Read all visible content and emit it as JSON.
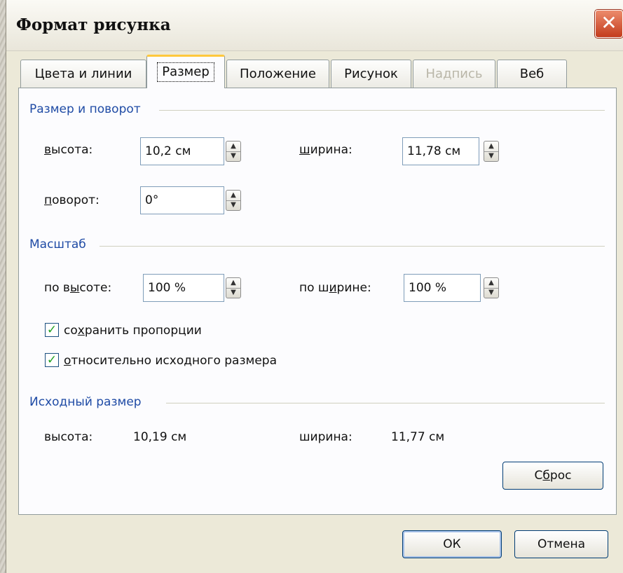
{
  "dialog": {
    "title": "Формат рисунка",
    "close_glyph": "✕"
  },
  "tabs": [
    {
      "label": "Цвета и линии",
      "state": "normal"
    },
    {
      "label": "Размер",
      "state": "active"
    },
    {
      "label": "Положение",
      "state": "normal"
    },
    {
      "label": "Рисунок",
      "state": "normal"
    },
    {
      "label": "Надпись",
      "state": "disabled"
    },
    {
      "label": "Веб",
      "state": "normal"
    }
  ],
  "size_rotation": {
    "section_title": "Размер и поворот",
    "height_label_u": "в",
    "height_label_rest": "ысота:",
    "height_value": "10,2 см",
    "width_label_u": "ш",
    "width_label_rest": "ирина:",
    "width_value": "11,78 см",
    "rotation_label_u": "п",
    "rotation_label_rest": "оворот:",
    "rotation_value": "0°"
  },
  "scale": {
    "section_title": "Масштаб",
    "height_label_a": "по в",
    "height_label_u": "ы",
    "height_label_b": "соте:",
    "height_value": "100 %",
    "width_label_a": "по ш",
    "width_label_u": "и",
    "width_label_b": "рине:",
    "width_value": "100 %",
    "keep_ratio_a": "со",
    "keep_ratio_u": "х",
    "keep_ratio_b": "ранить пропорции",
    "keep_ratio_checked": true,
    "relative_u": "о",
    "relative_b": "тносительно исходного размера",
    "relative_checked": true
  },
  "original_size": {
    "section_title": "Исходный размер",
    "height_label": "высота:",
    "height_value": "10,19 см",
    "width_label": "ширина:",
    "width_value": "11,77 см"
  },
  "buttons": {
    "reset_a": "С",
    "reset_u": "б",
    "reset_b": "рос",
    "ok": "ОК",
    "cancel": "Отмена"
  },
  "spinner_glyphs": {
    "up": "▲",
    "down": "▼"
  },
  "check_glyph": "✓",
  "colors": {
    "section_title": "#1f4ba5",
    "dialog_bg": "#ece9d8",
    "active_tab_accent": "#ffc83c",
    "check": "#21a121",
    "close_button": "#c33c1d"
  }
}
